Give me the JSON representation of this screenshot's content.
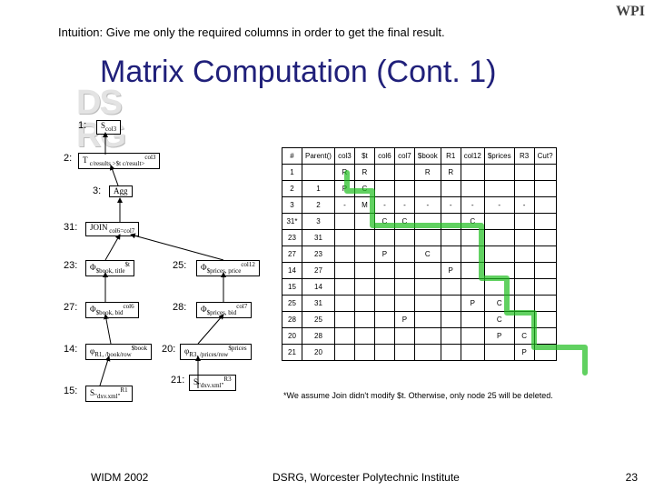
{
  "logo": "WPI",
  "intuition": "Intuition: Give me only the required columns in order to get the final result.",
  "title": "Matrix Computation (Cont. 1)",
  "background_text": "DSRG",
  "tree": {
    "n1": {
      "num": "1:",
      "label": "S",
      "sub": "col3"
    },
    "n2": {
      "num": "2:",
      "label": "T ",
      "sub": "c/results >$t c/result>",
      "sup": "col3"
    },
    "n3": {
      "num": "3:",
      "label": "Agg"
    },
    "n31": {
      "num": "31:",
      "label": "JOIN",
      "sub": " col6=col7"
    },
    "n23": {
      "num": "23:",
      "label": "Φ",
      "sub": "$book, title",
      "sup": "$t"
    },
    "n25": {
      "num": "25:",
      "label": "Φ",
      "sub": "$prices, price",
      "sup": "col12"
    },
    "n27": {
      "num": "27:",
      "label": "Φ",
      "sub": "$book, bid",
      "sup": "col6"
    },
    "n28": {
      "num": "28:",
      "label": "Φ",
      "sub": "$prices, bid",
      "sup": "col7"
    },
    "n14": {
      "num": "14:",
      "label": "φ",
      "sub": "R1, /book/row",
      "sup": "$book"
    },
    "n20": {
      "num": "20:",
      "label": "φ",
      "sub": "R3, /prices/row",
      "sup": "$prices"
    },
    "n15": {
      "num": "15:",
      "label": "S",
      "sub": "\"dxv.xml\"",
      "sup": "R1"
    },
    "n21": {
      "num": "21:",
      "label": "S",
      "sub": "\"dxv.xml\"",
      "sup": "R3"
    }
  },
  "table": {
    "headers": [
      "#",
      "Parent()",
      "col3",
      "$t",
      "col6",
      "col7",
      "$book",
      "R1",
      "col12",
      "$prices",
      "R3",
      "Cut?"
    ],
    "rows": [
      [
        "1",
        "",
        "R",
        "R",
        "",
        "",
        "R",
        "R",
        "",
        "",
        "",
        ""
      ],
      [
        "2",
        "1",
        "P",
        "C",
        "",
        "",
        "",
        "",
        "",
        "",
        "",
        ""
      ],
      [
        "3",
        "2",
        "-",
        "M",
        "-",
        "-",
        "-",
        "-",
        "-",
        "-",
        "-",
        ""
      ],
      [
        "31*",
        "3",
        "",
        "",
        "C",
        "C",
        "",
        "",
        "C",
        "",
        "",
        ""
      ],
      [
        "23",
        "31",
        "",
        "",
        "",
        "",
        "",
        "",
        "",
        "",
        "",
        ""
      ],
      [
        "27",
        "23",
        "",
        "",
        "P",
        "",
        "C",
        "",
        "",
        "",
        "",
        ""
      ],
      [
        "14",
        "27",
        "",
        "",
        "",
        "",
        "",
        "P",
        "",
        "",
        "",
        ""
      ],
      [
        "15",
        "14",
        "",
        "",
        "",
        "",
        "",
        "",
        "",
        "",
        "",
        ""
      ],
      [
        "25",
        "31",
        "",
        "",
        "",
        "",
        "",
        "",
        "P",
        "C",
        "",
        ""
      ],
      [
        "28",
        "25",
        "",
        "",
        "",
        "P",
        "",
        "",
        "",
        "C",
        "",
        ""
      ],
      [
        "20",
        "28",
        "",
        "",
        "",
        "",
        "",
        "",
        "",
        "P",
        "C",
        ""
      ],
      [
        "21",
        "20",
        "",
        "",
        "",
        "",
        "",
        "",
        "",
        "",
        "P",
        ""
      ]
    ]
  },
  "footnote": "*We assume Join didn't modify $t. Otherwise, only node 25 will be deleted.",
  "footer_left": "WIDM 2002",
  "footer_mid": "DSRG, Worcester Polytechnic Institute",
  "footer_right": "23"
}
